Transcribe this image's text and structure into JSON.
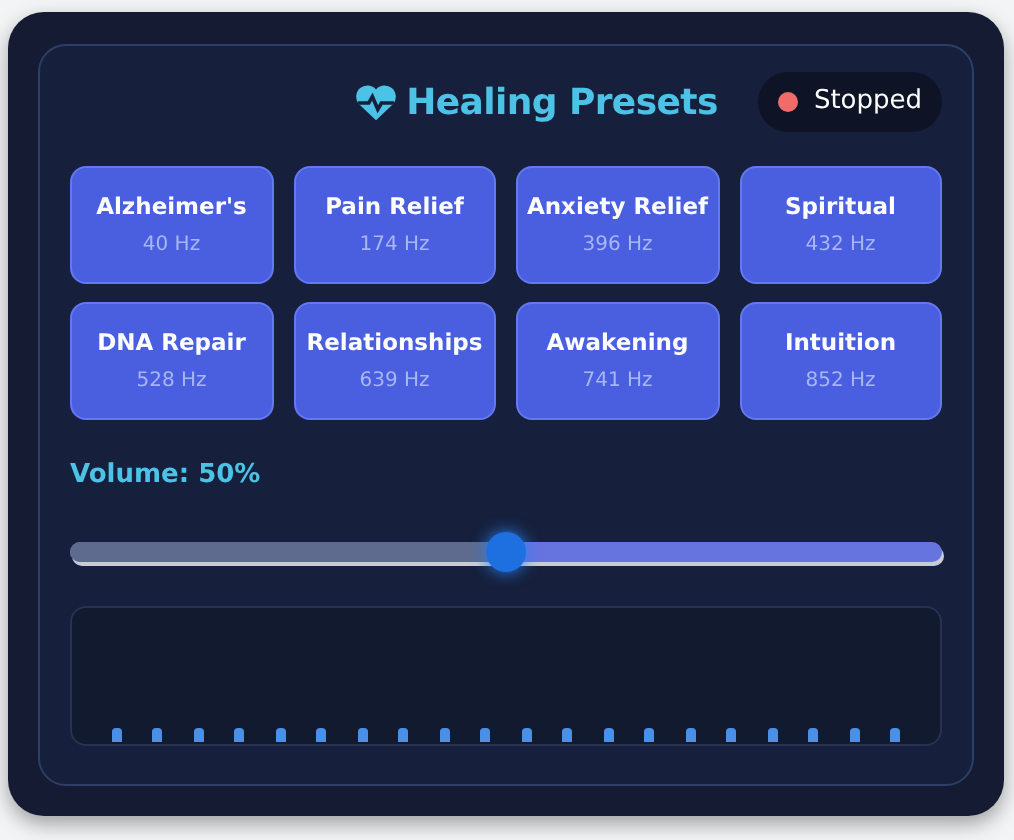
{
  "title": "Healing Presets",
  "status": {
    "label": "Stopped",
    "running": false
  },
  "presets": [
    {
      "name": "Alzheimer's",
      "frequency": "40 Hz"
    },
    {
      "name": "Pain Relief",
      "frequency": "174 Hz"
    },
    {
      "name": "Anxiety Relief",
      "frequency": "396 Hz"
    },
    {
      "name": "Spiritual",
      "frequency": "432 Hz"
    },
    {
      "name": "DNA Repair",
      "frequency": "528 Hz"
    },
    {
      "name": "Relationships",
      "frequency": "639 Hz"
    },
    {
      "name": "Awakening",
      "frequency": "741 Hz"
    },
    {
      "name": "Intuition",
      "frequency": "852 Hz"
    }
  ],
  "volume": {
    "label": "Volume: 50%",
    "level": 0.5
  }
}
